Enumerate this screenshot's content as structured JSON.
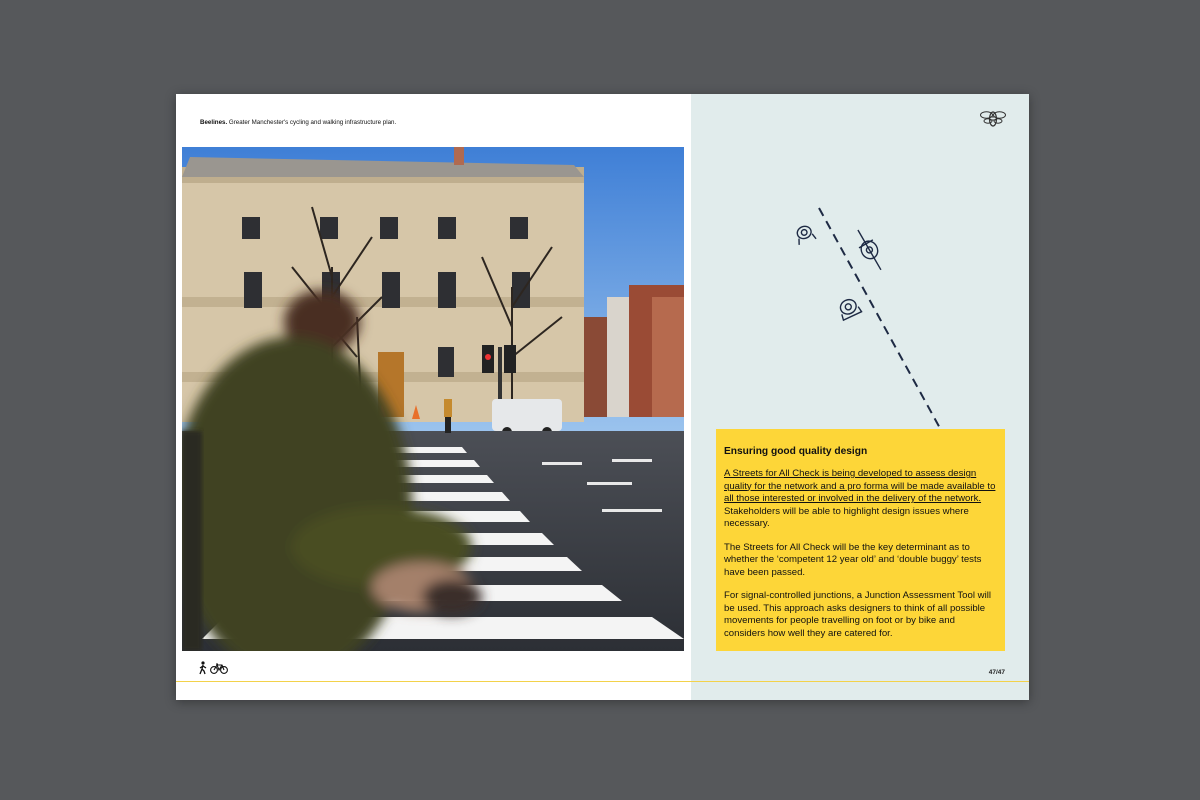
{
  "header": {
    "brand": "Beelines.",
    "subtitle": "Greater Manchester's cycling and walking infrastructure plan."
  },
  "callout": {
    "heading": "Ensuring good quality design",
    "p1_underlined": "A Streets for All Check is being developed to assess design quality for the network and a pro forma will be made available to all those interested or involved in the delivery of the network.",
    "p1_rest": " Stakeholders will be able to highlight design issues where necessary.",
    "p2": "The Streets for All Check will be the key determinant as to whether the ‘competent 12 year old’ and ‘double buggy’ tests have been passed.",
    "p3": "For signal-controlled junctions, a Junction Assessment Tool will be used. This approach asks designers to think of all possible movements for people travelling on foot or by bike and considers how well they are catered for."
  },
  "footer": {
    "page_number": "47/47"
  },
  "icons": {
    "footer": [
      "walking-person-icon",
      "bicycle-icon"
    ],
    "logo": "bee-icon"
  },
  "colors": {
    "background": "#56585b",
    "right_page": "#e1ecec",
    "callout": "#fdd638",
    "footer_rule": "#f3d24a"
  }
}
